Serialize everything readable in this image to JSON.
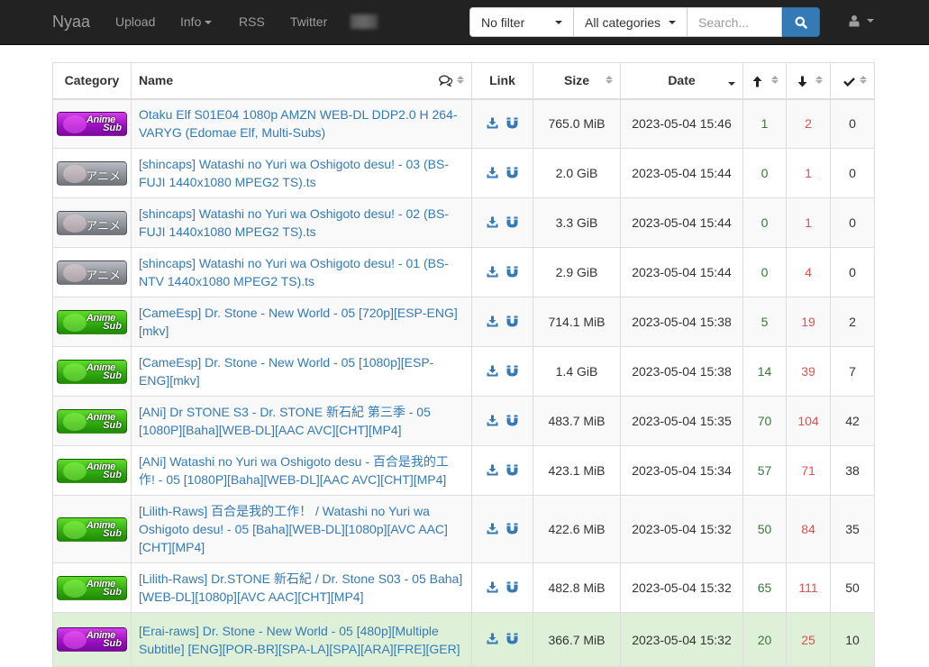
{
  "navbar": {
    "brand": "Nyaa",
    "links": [
      {
        "label": "Upload"
      },
      {
        "label": "Info",
        "dropdown": true
      },
      {
        "label": "RSS"
      },
      {
        "label": "Twitter"
      }
    ],
    "filter_select": {
      "selected": "No filter"
    },
    "category_select": {
      "selected": "All categories"
    },
    "search": {
      "placeholder": "Search...",
      "value": ""
    },
    "search_button_icon": "search-icon",
    "user_menu_icon": "user-icon"
  },
  "table": {
    "headers": {
      "category": "Category",
      "name": "Name",
      "link": "Link",
      "size": "Size",
      "date": "Date",
      "seeders_icon": "arrow-up-icon",
      "leechers_icon": "arrow-down-icon",
      "completed_icon": "check-icon",
      "comments_icon": "comments-icon"
    },
    "sort": {
      "column": "date",
      "direction": "desc"
    },
    "rows": [
      {
        "category": "Anime - Non-English-translated",
        "badge": {
          "style": "purple",
          "line1": "Anime",
          "line2": "Sub"
        },
        "name": "Otaku Elf S01E04 1080p AMZN WEB-DL DDP2.0 H 264-VARYG (Edomae Elf, Multi-Subs)",
        "size": "765.0 MiB",
        "date": "2023-05-04 15:46",
        "seeders": "1",
        "leechers": "2",
        "completed": "0",
        "row_style": "odd"
      },
      {
        "category": "Anime - Raw",
        "badge": {
          "style": "gray",
          "text": "アニメ"
        },
        "name": "[shincaps] Watashi no Yuri wa Oshigoto desu! - 03 (BS-FUJI 1440x1080 MPEG2 TS).ts",
        "size": "2.0 GiB",
        "date": "2023-05-04 15:44",
        "seeders": "0",
        "leechers": "1",
        "completed": "0",
        "row_style": "even"
      },
      {
        "category": "Anime - Raw",
        "badge": {
          "style": "gray",
          "text": "アニメ"
        },
        "name": "[shincaps] Watashi no Yuri wa Oshigoto desu! - 02 (BS-FUJI 1440x1080 MPEG2 TS).ts",
        "size": "3.3 GiB",
        "date": "2023-05-04 15:44",
        "seeders": "0",
        "leechers": "1",
        "completed": "0",
        "row_style": "odd"
      },
      {
        "category": "Anime - Raw",
        "badge": {
          "style": "gray",
          "text": "アニメ"
        },
        "name": "[shincaps] Watashi no Yuri wa Oshigoto desu! - 01 (BS-NTV 1440x1080 MPEG2 TS).ts",
        "size": "2.9 GiB",
        "date": "2023-05-04 15:44",
        "seeders": "0",
        "leechers": "4",
        "completed": "0",
        "row_style": "even"
      },
      {
        "category": "Anime - Non-English-translated",
        "badge": {
          "style": "green",
          "line1": "Anime",
          "line2": "Sub"
        },
        "name": "[CameEsp] Dr. Stone - New World - 05 [720p][ESP-ENG][mkv]",
        "size": "714.1 MiB",
        "date": "2023-05-04 15:38",
        "seeders": "5",
        "leechers": "19",
        "completed": "2",
        "row_style": "odd"
      },
      {
        "category": "Anime - Non-English-translated",
        "badge": {
          "style": "green",
          "line1": "Anime",
          "line2": "Sub"
        },
        "name": "[CameEsp] Dr. Stone - New World - 05 [1080p][ESP-ENG][mkv]",
        "size": "1.4 GiB",
        "date": "2023-05-04 15:38",
        "seeders": "14",
        "leechers": "39",
        "completed": "7",
        "row_style": "even"
      },
      {
        "category": "Anime - Non-English-translated",
        "badge": {
          "style": "green",
          "line1": "Anime",
          "line2": "Sub"
        },
        "name": "[ANi] Dr STONE S3 - Dr. STONE 新石紀 第三季 - 05 [1080P][Baha][WEB-DL][AAC AVC][CHT][MP4]",
        "size": "483.7 MiB",
        "date": "2023-05-04 15:35",
        "seeders": "70",
        "leechers": "104",
        "completed": "42",
        "row_style": "odd"
      },
      {
        "category": "Anime - Non-English-translated",
        "badge": {
          "style": "green",
          "line1": "Anime",
          "line2": "Sub"
        },
        "name": "[ANi] Watashi no Yuri wa Oshigoto desu - 百合是我的工作! - 05 [1080P][Baha][WEB-DL][AAC AVC][CHT][MP4]",
        "size": "423.1 MiB",
        "date": "2023-05-04 15:34",
        "seeders": "57",
        "leechers": "71",
        "completed": "38",
        "row_style": "even"
      },
      {
        "category": "Anime - Non-English-translated",
        "badge": {
          "style": "green",
          "line1": "Anime",
          "line2": "Sub"
        },
        "name": "[Lilith-Raws] 百合是我的工作！ / Watashi no Yuri wa Oshigoto desu! - 05 [Baha][WEB-DL][1080p][AVC AAC][CHT][MP4]",
        "size": "422.6 MiB",
        "date": "2023-05-04 15:32",
        "seeders": "50",
        "leechers": "84",
        "completed": "35",
        "row_style": "odd"
      },
      {
        "category": "Anime - Non-English-translated",
        "badge": {
          "style": "green",
          "line1": "Anime",
          "line2": "Sub"
        },
        "name": "[Lilith-Raws] Dr.STONE 新石紀 / Dr. Stone S03 - 05 Baha][WEB-DL][1080p][AVC AAC][CHT][MP4]",
        "size": "482.8 MiB",
        "date": "2023-05-04 15:32",
        "seeders": "65",
        "leechers": "111",
        "completed": "50",
        "row_style": "even"
      },
      {
        "category": "Anime - Non-English-translated",
        "badge": {
          "style": "purple",
          "line1": "Anime",
          "line2": "Sub"
        },
        "name": "[Erai-raws] Dr. Stone - New World - 05 [480p][Multiple Subtitle] [ENG][POR-BR][SPA-LA][SPA][ARA][FRE][GER]",
        "size": "366.7 MiB",
        "date": "2023-05-04 15:32",
        "seeders": "20",
        "leechers": "25",
        "completed": "10",
        "row_style": "success"
      }
    ]
  },
  "colors": {
    "navbar_bg": "#222222",
    "link": "#337ab7",
    "seeders": "#3c763d",
    "leechers": "#d9534f",
    "trusted_row_bg": "#dff0d8"
  }
}
